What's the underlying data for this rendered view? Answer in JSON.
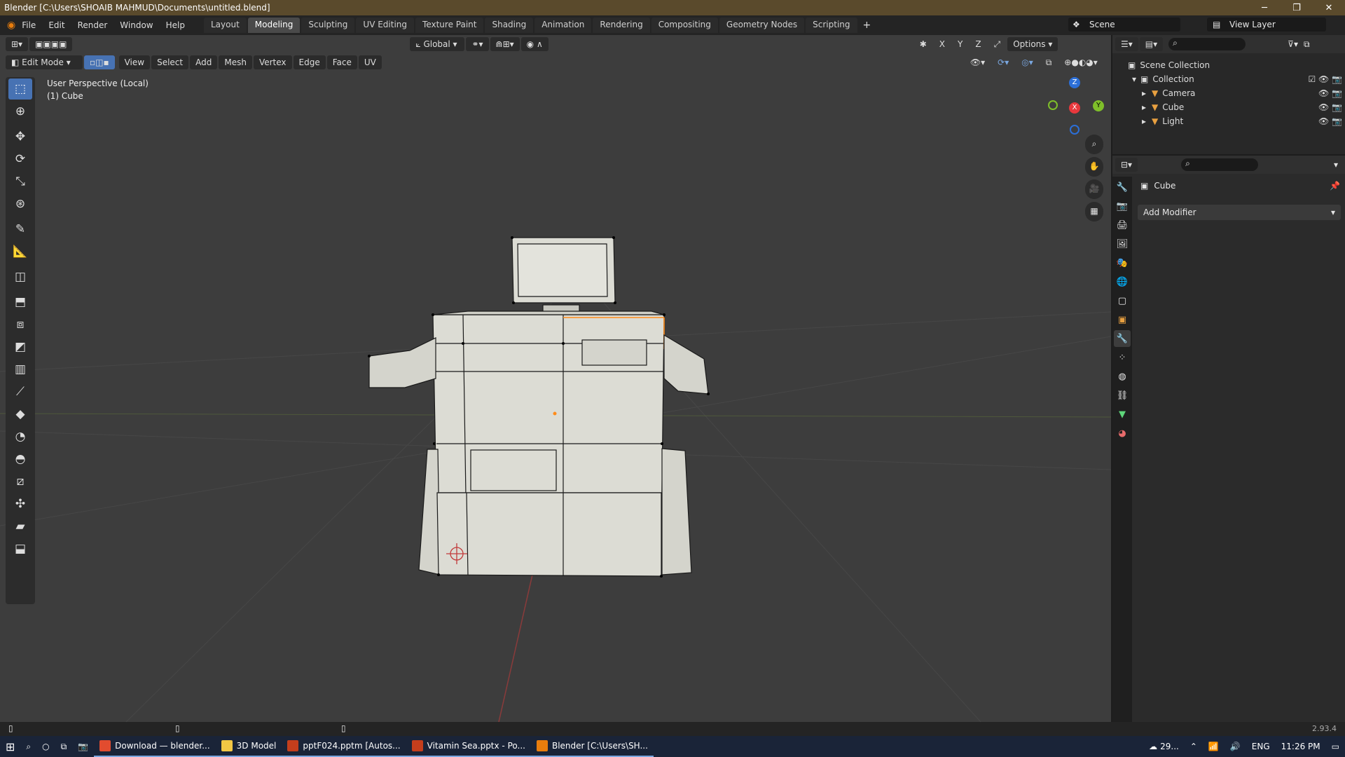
{
  "window": {
    "title": "Blender [C:\\Users\\SHOAIB MAHMUD\\Documents\\untitled.blend]",
    "minimize": "─",
    "maximize": "❐",
    "close": "✕"
  },
  "menu": [
    "File",
    "Edit",
    "Render",
    "Window",
    "Help"
  ],
  "workspaces": [
    "Layout",
    "Modeling",
    "Sculpting",
    "UV Editing",
    "Texture Paint",
    "Shading",
    "Animation",
    "Rendering",
    "Compositing",
    "Geometry Nodes",
    "Scripting"
  ],
  "active_workspace": "Modeling",
  "add_workspace": "+",
  "scene": "Scene",
  "view_layer": "View Layer",
  "viewport": {
    "transform_orientation": "Global",
    "options_label": "Options",
    "mode": "Edit Mode",
    "menus": [
      "View",
      "Select",
      "Add",
      "Mesh",
      "Vertex",
      "Edge",
      "Face",
      "UV"
    ],
    "axis_labels": [
      "X",
      "Y",
      "Z"
    ],
    "info_line1": "User Perspective (Local)",
    "info_line2": "(1) Cube",
    "gizmo": {
      "x": "X",
      "y": "Y",
      "z": "Z"
    }
  },
  "outliner": {
    "root": "Scene Collection",
    "collection": "Collection",
    "items": [
      {
        "name": "Camera",
        "color": "#e8a040"
      },
      {
        "name": "Cube",
        "color": "#e8a040"
      },
      {
        "name": "Light",
        "color": "#e8a040"
      }
    ]
  },
  "properties": {
    "object_name": "Cube",
    "add_modifier": "Add Modifier"
  },
  "statusbar": {
    "version": "2.93.4"
  },
  "taskbar": {
    "items": [
      {
        "label": "Download — blender...",
        "color": "#e24c2f"
      },
      {
        "label": "3D Model",
        "color": "#f2c744"
      },
      {
        "label": "pptF024.pptm [Autos...",
        "color": "#c43e1c"
      },
      {
        "label": "Vitamin Sea.pptx - Po...",
        "color": "#c43e1c"
      },
      {
        "label": "Blender [C:\\Users\\SH...",
        "color": "#e87d0d"
      }
    ],
    "weather": "29...",
    "lang": "ENG",
    "time": "11:26 PM"
  },
  "colors": {
    "accent": "#4772b3",
    "viewport_bg": "#3d3d3d",
    "mesh_face": "#dcdcd4",
    "selected_edge": "#ff8c1a"
  }
}
